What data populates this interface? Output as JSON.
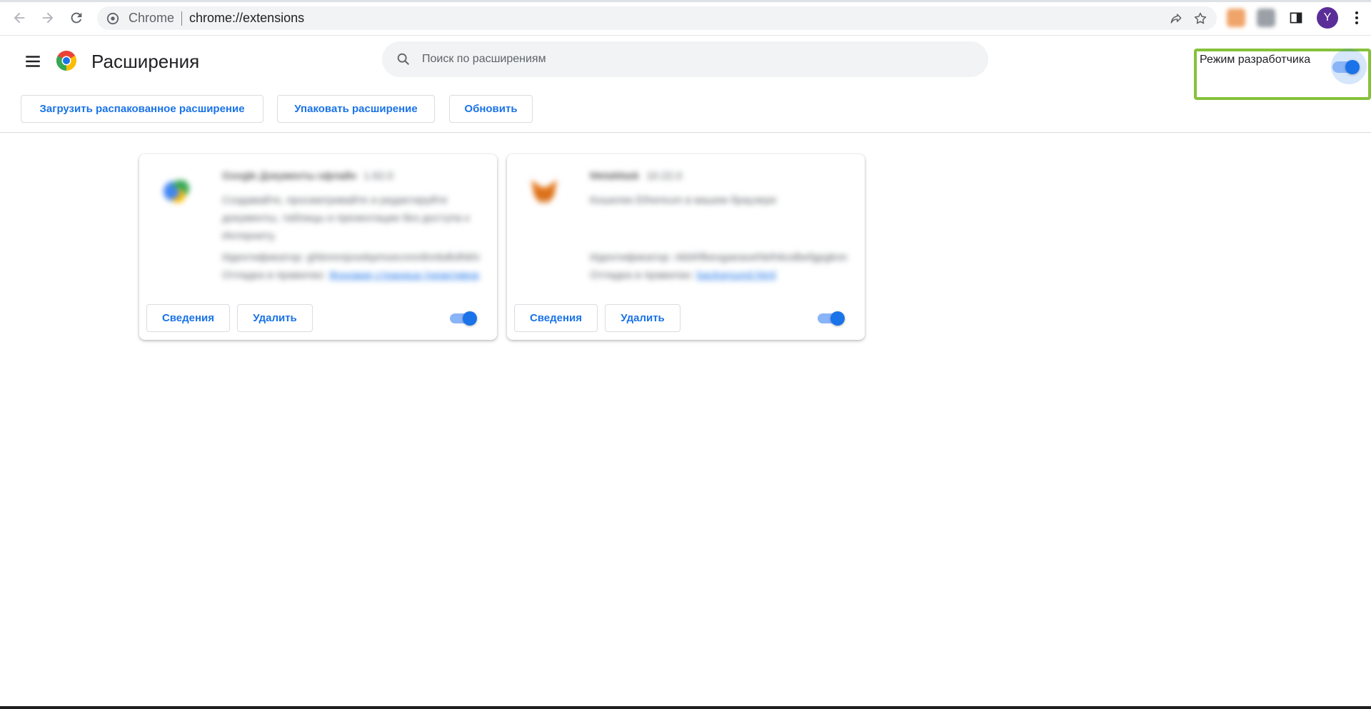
{
  "browser": {
    "site_name": "Chrome",
    "url": "chrome://extensions",
    "avatar_letter": "Y"
  },
  "header": {
    "title": "Расширения",
    "search_placeholder": "Поиск по расширениям",
    "dev_mode_label": "Режим разработчика",
    "dev_mode_on": true
  },
  "actions": {
    "load_unpacked": "Загрузить распакованное расширение",
    "pack": "Упаковать расширение",
    "update": "Обновить"
  },
  "extensions": [
    {
      "name": "Google Документы офлайн",
      "version": "1.62.0",
      "description": "Создавайте, просматривайте и редактируйте документы, таблицы и презентации без доступа к Интернету.",
      "id_line": "Идентификатор: ghbmnnjooekpmoecnnnilnnbdlolhkhi",
      "source_prefix": "Отладка в правилах",
      "source_link": "Фоновая страница (неактивна)",
      "details_label": "Сведения",
      "remove_label": "Удалить",
      "enabled": true,
      "icon": "google-docs-offline-icon"
    },
    {
      "name": "MetaMask",
      "version": "10.22.0",
      "description": "Кошелек Ethereum в вашем браузере",
      "id_line": "Идентификатор: nkbihfbeogaeaoehlefnkodbefgpgknn",
      "source_prefix": "Отладка в правилах",
      "source_link": "background.html",
      "details_label": "Сведения",
      "remove_label": "Удалить",
      "enabled": true,
      "icon": "metamask-fox-icon"
    }
  ],
  "colors": {
    "accent": "#1a73e8",
    "highlight": "#86c13b"
  }
}
